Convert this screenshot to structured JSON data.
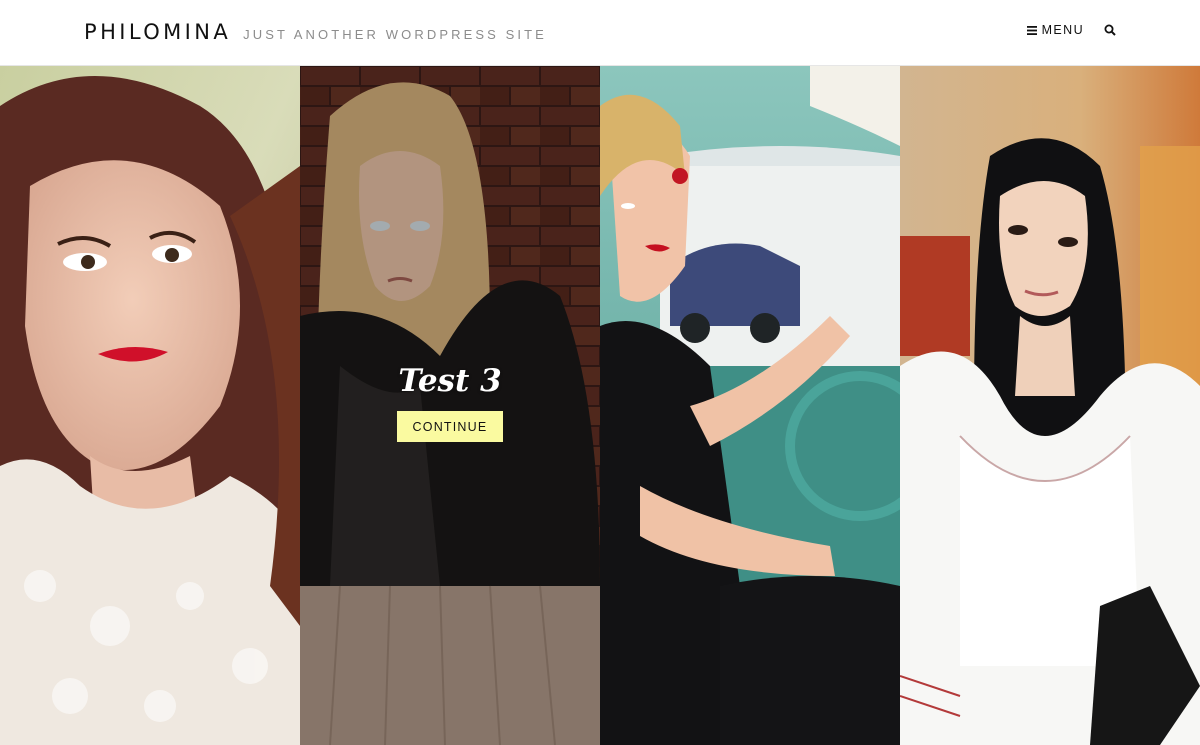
{
  "header": {
    "site_title": "PHILOMINA",
    "tagline": "JUST ANOTHER WORDPRESS SITE",
    "menu_label": "MENU",
    "icons": [
      "hamburger-icon",
      "search-icon"
    ]
  },
  "panels": [
    {
      "photo": "woman-dark-hair-white-lace"
    },
    {
      "photo": "woman-blonde-leather-jacket",
      "post_title": "Test 3",
      "button_label": "CONTINUE"
    },
    {
      "photo": "woman-vintage-car-driver"
    },
    {
      "photo": "woman-long-black-hair-white-jacket"
    }
  ],
  "colors": {
    "button_bg": "#fafaa0",
    "header_bg": "#ffffff",
    "title_text": "#111111",
    "tagline_text": "#8c8c8c"
  }
}
